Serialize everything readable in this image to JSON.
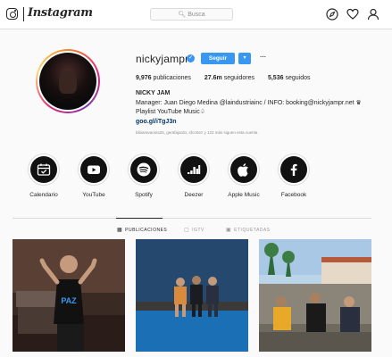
{
  "nav": {
    "brand": "Instagram",
    "search_placeholder": "Busca",
    "icons": [
      "instagram-logo-icon",
      "compass-icon",
      "heart-icon",
      "user-icon"
    ]
  },
  "profile": {
    "username": "nickyjampr",
    "verified_mark": "✓",
    "follow_label": "Seguir",
    "dropdown_label": "▾",
    "more_label": "···",
    "stats": {
      "posts": "9,976",
      "posts_label": "publicaciones",
      "followers": "27.6m",
      "followers_label": "seguidores",
      "following": "5,536",
      "following_label": "seguidos"
    },
    "display_name": "NICKY JAM",
    "bio_line1": "Manager: Juan Diego Medina @laindustriainc / INFO: booking@nickyjampr.net ♛",
    "bio_line2": "Playlist YouTube Music♤",
    "bio_link": "goo.gl/iTgJ3n",
    "followed_by": "bibiaravaonia25, gerafajardo, sfcortez y 122 más siguen esta cuenta"
  },
  "highlights": [
    {
      "label": "Calendario",
      "icon": "calendar-icon"
    },
    {
      "label": "YouTube",
      "icon": "youtube-icon"
    },
    {
      "label": "Spotify",
      "icon": "spotify-icon"
    },
    {
      "label": "Deezer",
      "icon": "deezer-icon"
    },
    {
      "label": "Apple Music",
      "icon": "apple-icon"
    },
    {
      "label": "Facebook",
      "icon": "facebook-icon"
    }
  ],
  "tabs": [
    {
      "label": "PUBLICACIONES",
      "icon": "grid-icon",
      "active": true
    },
    {
      "label": "IGTV",
      "icon": "igtv-icon",
      "active": false
    },
    {
      "label": "ETIQUETADAS",
      "icon": "tag-icon",
      "active": false
    }
  ],
  "posts": [
    {
      "caption": "PAZ"
    },
    {
      "caption": ""
    },
    {
      "caption": ""
    }
  ],
  "colors": {
    "accent": "#3897f0",
    "link": "#003569",
    "border": "#dbdbdb",
    "background": "#fafafa"
  }
}
